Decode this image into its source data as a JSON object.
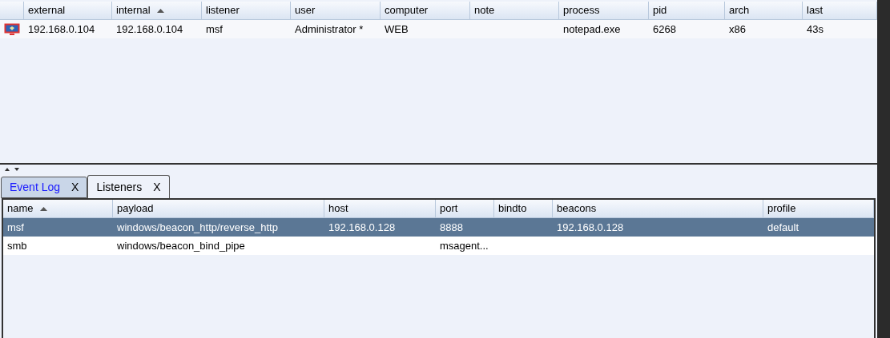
{
  "beacons_table": {
    "columns": [
      {
        "label": "external",
        "sorted": false
      },
      {
        "label": "internal",
        "sorted": true
      },
      {
        "label": "listener",
        "sorted": false
      },
      {
        "label": "user",
        "sorted": false
      },
      {
        "label": "computer",
        "sorted": false
      },
      {
        "label": "note",
        "sorted": false
      },
      {
        "label": "process",
        "sorted": false
      },
      {
        "label": "pid",
        "sorted": false
      },
      {
        "label": "arch",
        "sorted": false
      },
      {
        "label": "last",
        "sorted": false
      }
    ],
    "rows": [
      {
        "selected": false,
        "cells": [
          "192.168.0.104",
          "192.168.0.104",
          "msf",
          "Administrator *",
          "WEB",
          "",
          "notepad.exe",
          "6268",
          "x86",
          "43s"
        ]
      }
    ]
  },
  "tabs": [
    {
      "label": "Event Log",
      "close": "X",
      "selected": false
    },
    {
      "label": "Listeners",
      "close": "X",
      "selected": true
    }
  ],
  "listeners_table": {
    "columns": [
      {
        "label": "name",
        "sorted": true
      },
      {
        "label": "payload",
        "sorted": false
      },
      {
        "label": "host",
        "sorted": false
      },
      {
        "label": "port",
        "sorted": false
      },
      {
        "label": "bindto",
        "sorted": false
      },
      {
        "label": "beacons",
        "sorted": false
      },
      {
        "label": "profile",
        "sorted": false
      }
    ],
    "rows": [
      {
        "selected": true,
        "cells": [
          "msf",
          "windows/beacon_http/reverse_http",
          "192.168.0.128",
          "8888",
          "",
          "192.168.0.128",
          "default"
        ]
      },
      {
        "selected": false,
        "cells": [
          "smb",
          "windows/beacon_bind_pipe",
          "",
          "msagent...",
          "",
          "",
          ""
        ]
      }
    ]
  }
}
